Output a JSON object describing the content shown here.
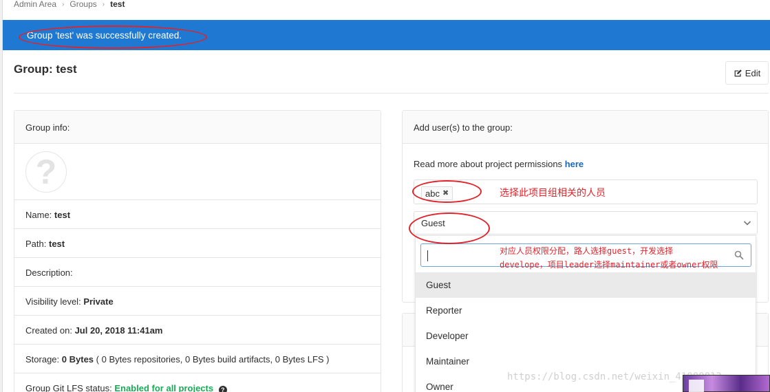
{
  "breadcrumb": [
    "Admin Area",
    "Groups",
    "test"
  ],
  "flash": {
    "message": "Group 'test' was successfully created."
  },
  "page": {
    "title": "Group: test",
    "edit_label": "Edit"
  },
  "group_info": {
    "heading": "Group info:",
    "rows": [
      {
        "label": "Name:",
        "value": "test"
      },
      {
        "label": "Path:",
        "value": "test"
      },
      {
        "label": "Description:",
        "value": ""
      },
      {
        "label": "Visibility level:",
        "value": "Private"
      },
      {
        "label": "Created on:",
        "value": "Jul 20, 2018 11:41am"
      },
      {
        "label": "Storage:",
        "value": "0 Bytes",
        "detail": "( 0 Bytes repositories, 0 Bytes build artifacts, 0 Bytes LFS )"
      },
      {
        "label": "Group Git LFS status:",
        "value": "Enabled for all projects"
      }
    ]
  },
  "add_users": {
    "heading": "Add user(s) to the group:",
    "read_more_text": "Read more about project permissions",
    "read_more_link": "here",
    "selected_user": "abc",
    "role_value": "Guest",
    "role_options": [
      "Guest",
      "Reporter",
      "Developer",
      "Maintainer",
      "Owner"
    ]
  },
  "annotations": {
    "users_note": "选择此项目组相关的人员",
    "role_note_line1": "对应人员权限分配，路人选择guest，开发选择",
    "role_note_line2": "develope，项目leader选择maintainer或者owner权限"
  },
  "watermark": "https://blog.csdn.net/weixin_41888813",
  "colors": {
    "flash_bg": "#1f78d1",
    "annotation": "#e0242b",
    "link": "#1b69b6",
    "success": "#1aaa55"
  }
}
